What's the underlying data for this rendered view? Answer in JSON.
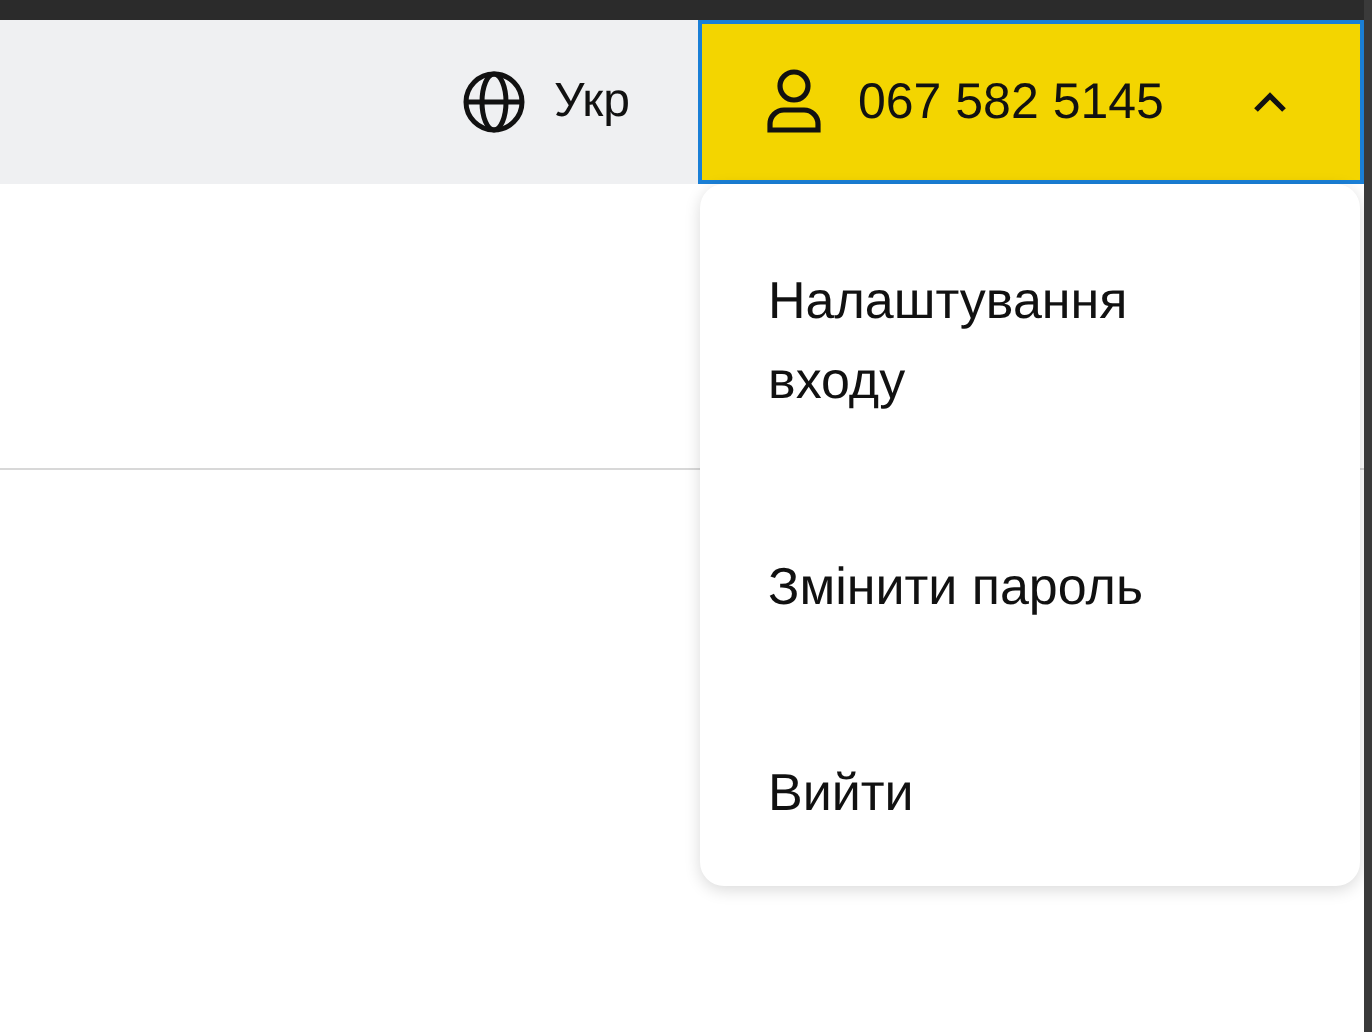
{
  "header": {
    "language": "Укр",
    "account": {
      "phone": "067 582 5145",
      "expanded": true
    }
  },
  "account_menu": [
    {
      "label": "Налаштування входу"
    },
    {
      "label": "Змінити пароль"
    },
    {
      "label": "Вийти"
    }
  ]
}
